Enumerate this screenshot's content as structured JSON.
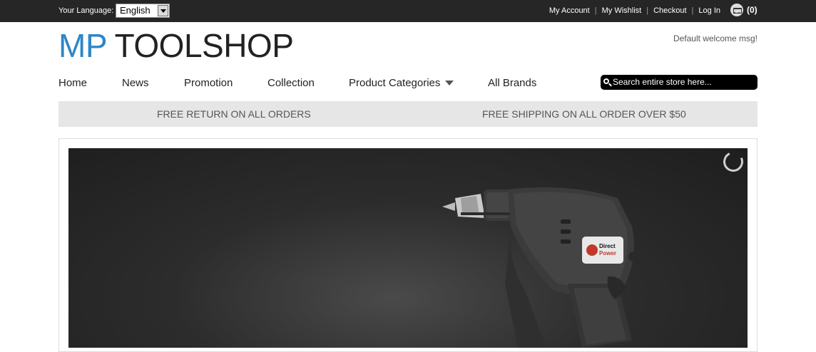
{
  "topbar": {
    "language_label": "Your Language:",
    "language_value": "English",
    "links": [
      "My Account",
      "My Wishlist",
      "Checkout",
      "Log In"
    ],
    "cart_count": "(0)"
  },
  "header": {
    "logo_prefix": "MP",
    "logo_suffix": " TOOLSHOP",
    "welcome": "Default welcome msg!"
  },
  "nav": {
    "items": [
      "Home",
      "News",
      "Promotion",
      "Collection",
      "Product Categories",
      "All Brands"
    ]
  },
  "search": {
    "placeholder": "Search entire store here..."
  },
  "promo": {
    "left": "FREE RETURN ON ALL ORDERS",
    "right": "FREE SHIPPING ON ALL ORDER OVER $50"
  },
  "banner": {
    "brand_line1": "Direct",
    "brand_line2": "Power"
  },
  "colors": {
    "topbar_bg": "#262626",
    "logo_accent": "#2e86c8",
    "promo_bg": "#e6e6e6",
    "banner_bg": "#2c2c2c"
  },
  "icons": [
    "dropdown-arrow-icon",
    "cart-icon",
    "chevron-down-icon",
    "search-icon",
    "loading-spinner-icon"
  ]
}
